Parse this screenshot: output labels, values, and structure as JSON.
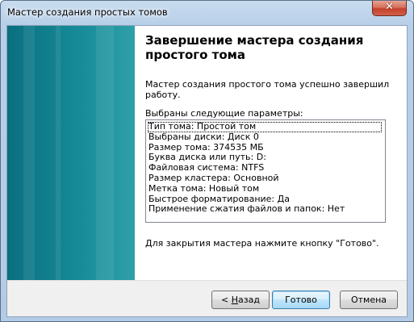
{
  "window": {
    "title": "Мастер создания простых томов",
    "close_glyph": "✕"
  },
  "page": {
    "heading": "Завершение мастера создания простого тома",
    "success_text": "Мастер создания простого тома успешно завершил работу.",
    "params_label": "Выбраны следующие параметры:",
    "params": [
      "Тип тома: Простой том",
      "Выбраны диски: Диск 0",
      "Размер тома: 374535 МБ",
      "Буква диска или путь: D:",
      "Файловая система: NTFS",
      "Размер кластера: Основной",
      "Метка тома: Новый том",
      "Быстрое форматирование: Да",
      "Применение сжатия файлов и папок: Нет"
    ],
    "close_hint": "Для закрытия мастера нажмите кнопку \"Готово\"."
  },
  "buttons": {
    "back_prefix": "< ",
    "back_mnemonic": "Н",
    "back_rest": "азад",
    "finish": "Готово",
    "cancel": "Отмена"
  },
  "colors": {
    "banner": "#168a98",
    "titlebar": "#b7cfe8",
    "close_button": "#c3412a"
  }
}
